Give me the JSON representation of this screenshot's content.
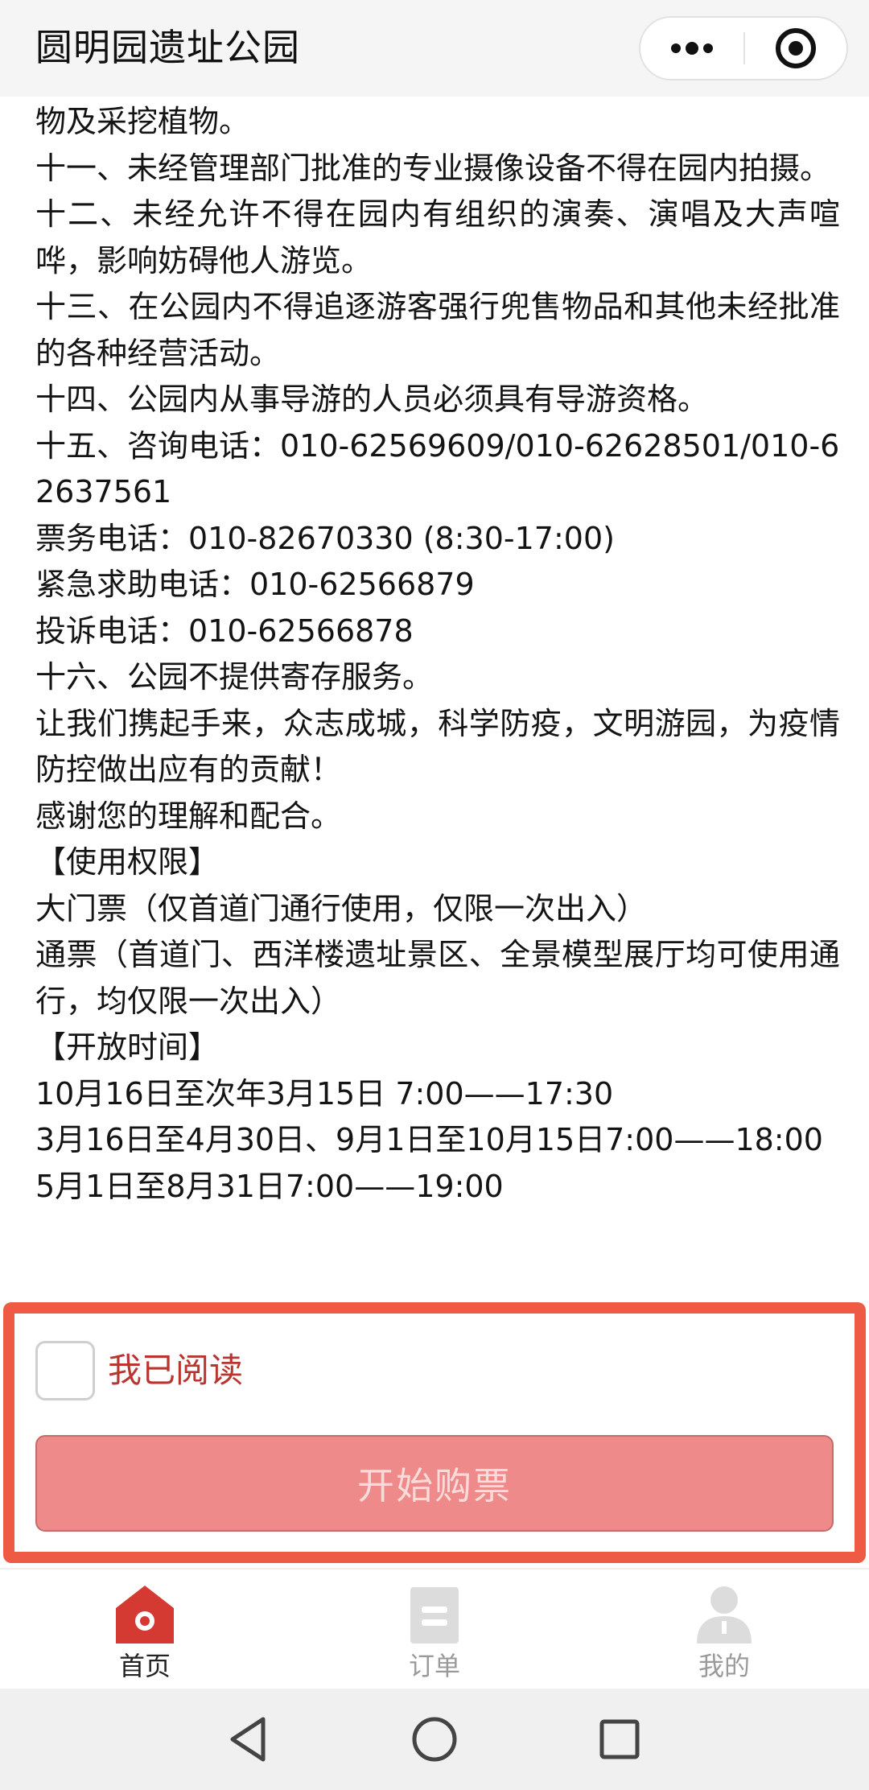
{
  "header": {
    "title": "圆明园遗址公园",
    "more_icon": "more-dots-icon",
    "close_icon": "target-close-icon"
  },
  "content": {
    "paragraphs": [
      "物及采挖植物。",
      "十一、未经管理部门批准的专业摄像设备不得在园内拍摄。",
      "十二、未经允许不得在园内有组织的演奏、演唱及大声喧哗，影响妨碍他人游览。",
      "十三、在公园内不得追逐游客强行兜售物品和其他未经批准的各种经营活动。",
      "十四、公园内从事导游的人员必须具有导游资格。",
      "十五、咨询电话：010-62569609/010-62628501/010-62637561",
      "票务电话：010-82670330 (8:30-17:00)",
      "紧急求助电话：010-62566879",
      "投诉电话：010-62566878",
      "十六、公园不提供寄存服务。",
      "让我们携起手来，众志成城，科学防疫，文明游园，为疫情防控做出应有的贡献！",
      "感谢您的理解和配合。",
      "【使用权限】",
      "大门票（仅首道门通行使用，仅限一次出入）",
      "通票（首道门、西洋楼遗址景区、全景模型展厅均可使用通行，均仅限一次出入）",
      "【开放时间】",
      "10月16日至次年3月15日 7:00——17:30",
      "3月16日至4月30日、9月1日至10月15日7:00——18:00",
      "5月1日至8月31日7:00——19:00"
    ]
  },
  "agreement": {
    "checkbox_checked": false,
    "label": "我已阅读",
    "buy_button": "开始购票",
    "highlight_color": "#ef5a44"
  },
  "tabbar": {
    "tabs": [
      {
        "label": "首页",
        "icon": "home-icon",
        "active": true
      },
      {
        "label": "订单",
        "icon": "orders-icon",
        "active": false
      },
      {
        "label": "我的",
        "icon": "user-icon",
        "active": false
      }
    ],
    "active_color": "#d43a32",
    "inactive_color": "#dcdcdc"
  },
  "system_nav": {
    "buttons": [
      "back-icon",
      "home-circle-icon",
      "recent-apps-icon"
    ]
  }
}
